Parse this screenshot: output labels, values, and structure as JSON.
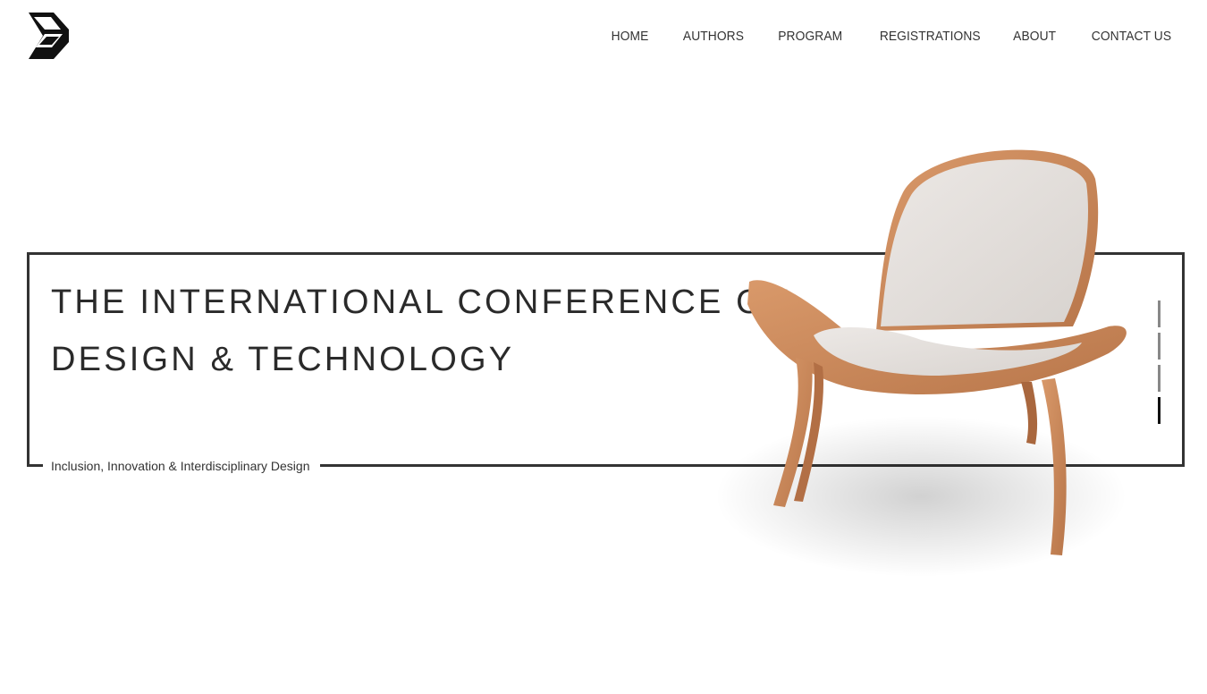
{
  "logo": {
    "icon": "conference-logo-icon"
  },
  "nav": {
    "items": [
      "HOME",
      "AUTHORS",
      "PROGRAM",
      "REGISTRATIONS",
      "ABOUT",
      "CONTACT US"
    ]
  },
  "hero": {
    "title_line1": "THE INTERNATIONAL CONFERENCE ON",
    "title_line2": "DESIGN & TECHNOLOGY",
    "tagline": "Inclusion, Innovation & Interdisciplinary Design",
    "image": "chair-image"
  },
  "slider": {
    "count": 4,
    "active_index": 3
  },
  "colors": {
    "frame": "#333333",
    "text": "#2a2a2a",
    "wood": "#c8875a",
    "cushion": "#e6e2df"
  }
}
